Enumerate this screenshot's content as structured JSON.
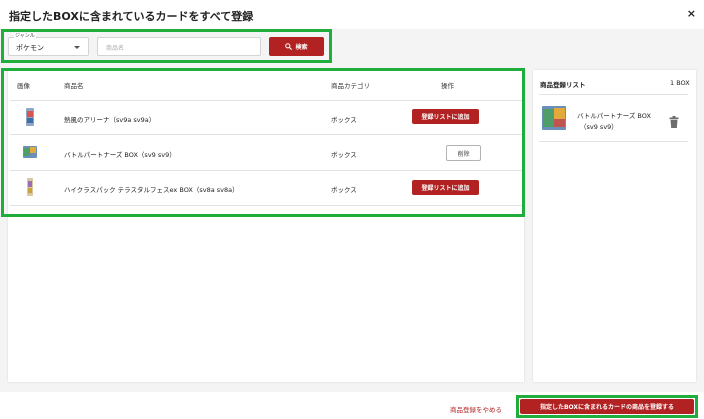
{
  "modal": {
    "title": "指定したBOXに含まれているカードをすべて登録",
    "close_label": "×"
  },
  "search": {
    "genre_caption": "ジャンル",
    "genre_value": "ポケモン",
    "name_placeholder": "商品名",
    "button_label": "検索"
  },
  "table": {
    "headers": {
      "image": "画像",
      "name": "商品名",
      "category": "商品カテゴリ",
      "action": "操作"
    },
    "rows": [
      {
        "name": "熱風のアリーナ（sv9a sv9a）",
        "category": "ボックス",
        "action": "登録リストに追加"
      },
      {
        "name": "バトルパートナーズ BOX（sv9 sv9）",
        "category": "ボックス",
        "action": "削除"
      },
      {
        "name": "ハイクラスパック テラスタルフェスex BOX（sv8a sv8a）",
        "category": "ボックス",
        "action": "登録リストに追加"
      }
    ]
  },
  "registration_list": {
    "title": "商品登録リスト",
    "count": "1 BOX",
    "items": [
      {
        "name": "バトルパートナーズ BOX",
        "code": "（sv9 sv9）"
      }
    ]
  },
  "footer": {
    "cancel_label": "商品登録をやめる",
    "submit_label": "指定したBOXに含まれるカードの商品を登録する"
  },
  "colors": {
    "primary": "#b22222",
    "highlight": "#1fae3c"
  },
  "icons": {
    "search": "search-icon",
    "dropdown": "chevron-down-icon",
    "delete": "trash-icon",
    "close": "close-icon"
  }
}
